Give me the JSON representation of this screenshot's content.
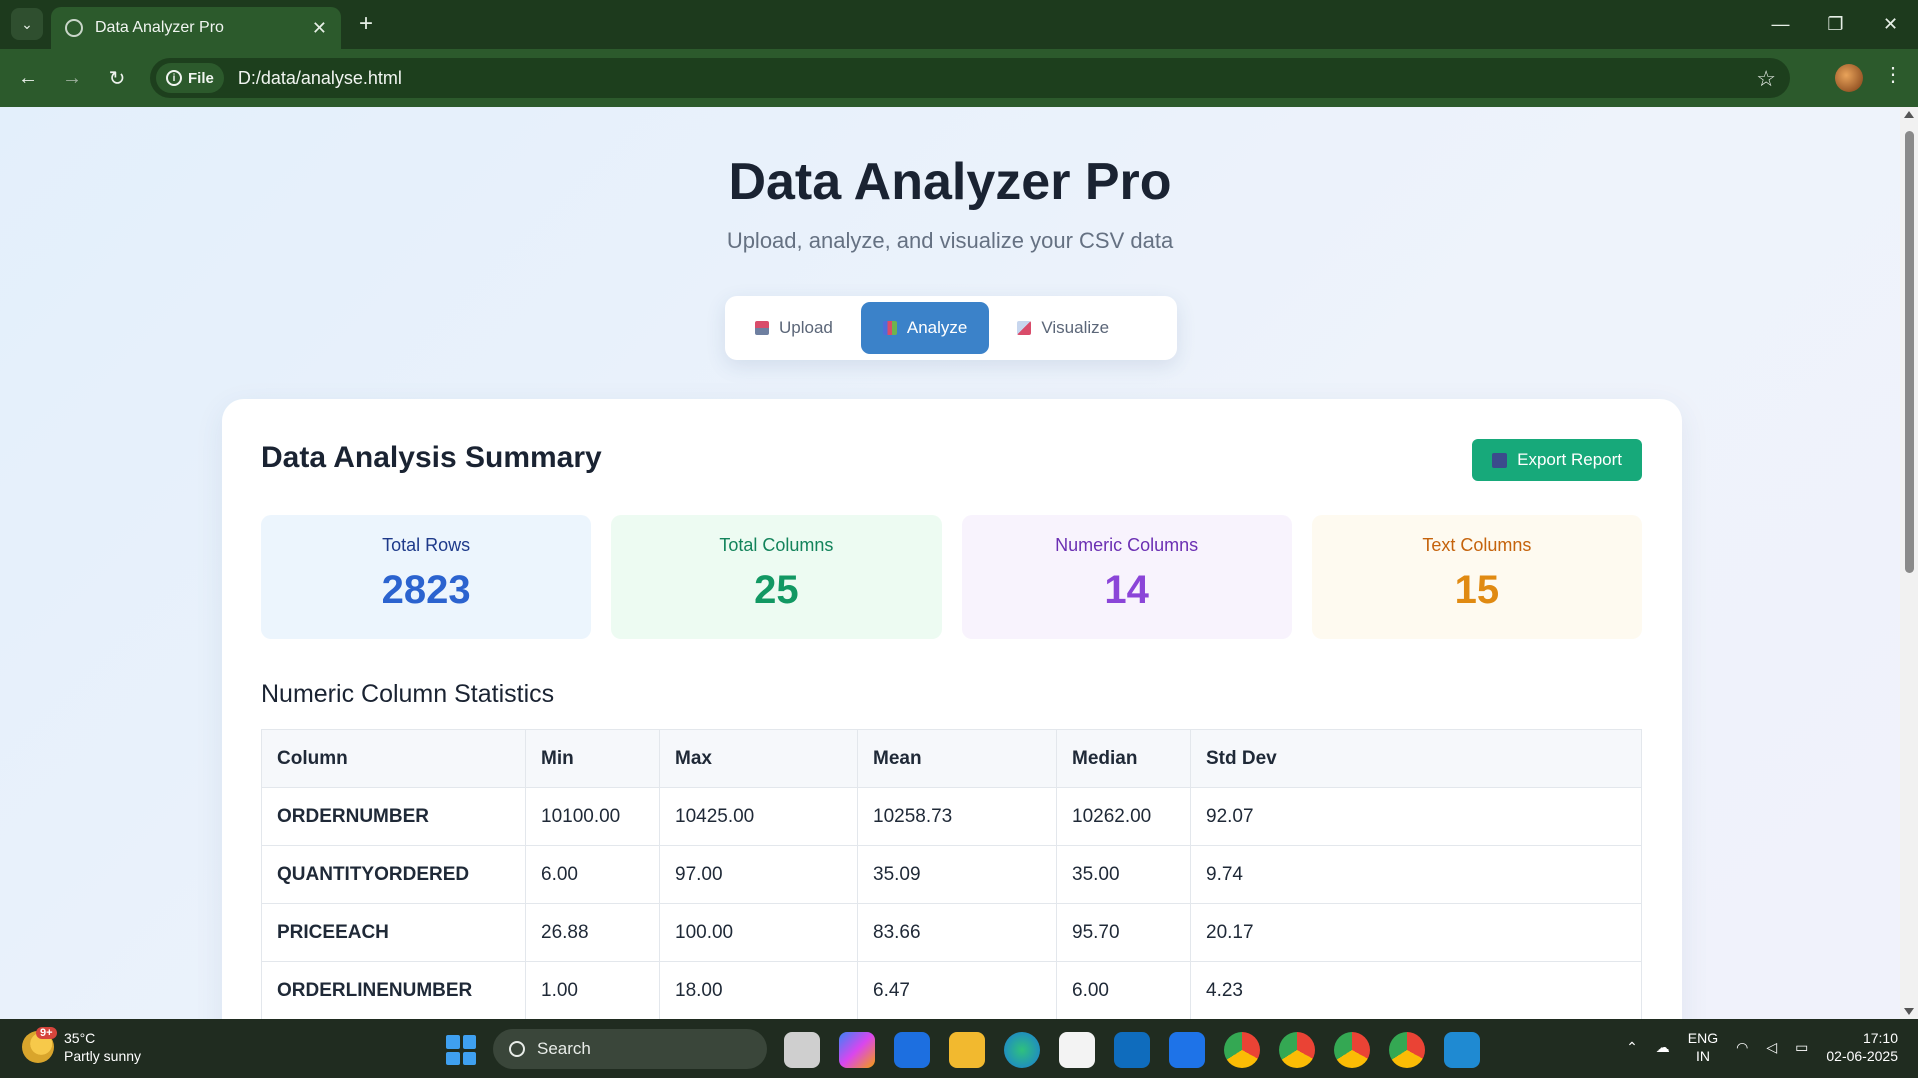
{
  "browser": {
    "tab_title": "Data Analyzer Pro",
    "chip_label": "File",
    "url": "D:/data/analyse.html"
  },
  "page": {
    "title": "Data Analyzer Pro",
    "subtitle": "Upload, analyze, and visualize your CSV data",
    "nav_tabs": [
      {
        "label": "Upload",
        "active": false
      },
      {
        "label": "Analyze",
        "active": true
      },
      {
        "label": "Visualize",
        "active": false
      }
    ],
    "summary": {
      "title": "Data Analysis Summary",
      "export_label": "Export Report",
      "stats": [
        {
          "label": "Total Rows",
          "value": "2823"
        },
        {
          "label": "Total Columns",
          "value": "25"
        },
        {
          "label": "Numeric Columns",
          "value": "14"
        },
        {
          "label": "Text Columns",
          "value": "15"
        }
      ]
    },
    "numeric_stats": {
      "title": "Numeric Column Statistics",
      "headers": [
        "Column",
        "Min",
        "Max",
        "Mean",
        "Median",
        "Std Dev"
      ],
      "rows": [
        [
          "ORDERNUMBER",
          "10100.00",
          "10425.00",
          "10258.73",
          "10262.00",
          "92.07"
        ],
        [
          "QUANTITYORDERED",
          "6.00",
          "97.00",
          "35.09",
          "35.00",
          "9.74"
        ],
        [
          "PRICEEACH",
          "26.88",
          "100.00",
          "83.66",
          "95.70",
          "20.17"
        ],
        [
          "ORDERLINENUMBER",
          "1.00",
          "18.00",
          "6.47",
          "6.00",
          "4.23"
        ]
      ]
    }
  },
  "taskbar": {
    "weather_badge": "9+",
    "temperature": "35°C",
    "weather": "Partly sunny",
    "search_label": "Search",
    "lang_top": "ENG",
    "lang_bottom": "IN",
    "time": "17:10",
    "date": "02-06-2025"
  }
}
